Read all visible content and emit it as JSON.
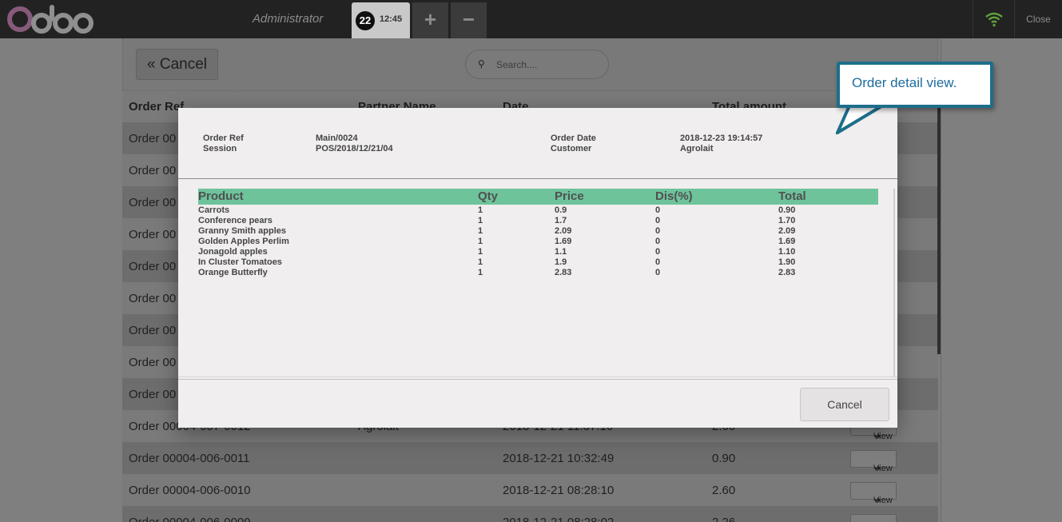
{
  "navbar": {
    "admin": "Administrator",
    "order_number": "22",
    "order_time": "12:45",
    "add_label": "+",
    "remove_label": "−",
    "close_label": "Close",
    "brand_colors": {
      "o1": "#875a7b",
      "o2": "#8f8f8f"
    }
  },
  "list": {
    "cancel_label": "Cancel",
    "search_placeholder": "Search....",
    "headers": {
      "order_ref": "Order Ref",
      "partner": "Partner Name",
      "date": "Date",
      "total": "Total amount"
    },
    "rows": [
      {
        "ref": "Order 00",
        "partner": "",
        "date": "",
        "total": "",
        "view": ""
      },
      {
        "ref": "Order 00",
        "partner": "",
        "date": "",
        "total": "",
        "view": ""
      },
      {
        "ref": "Order 00",
        "partner": "",
        "date": "",
        "total": "",
        "view": ""
      },
      {
        "ref": "Order 00",
        "partner": "",
        "date": "",
        "total": "",
        "view": ""
      },
      {
        "ref": "Order 00",
        "partner": "",
        "date": "",
        "total": "",
        "view": ""
      },
      {
        "ref": "Order 00",
        "partner": "",
        "date": "",
        "total": "",
        "view": ""
      },
      {
        "ref": "Order 00",
        "partner": "",
        "date": "",
        "total": "",
        "view": ""
      },
      {
        "ref": "Order 00",
        "partner": "",
        "date": "",
        "total": "",
        "view": ""
      },
      {
        "ref": "Order 00",
        "partner": "",
        "date": "",
        "total": "",
        "view": ""
      },
      {
        "ref": "Order 00004-007-0012",
        "partner": "Agrolait",
        "date": "2018-12-21 11:37:10",
        "total": "2.60",
        "view": "View"
      },
      {
        "ref": "Order 00004-006-0011",
        "partner": "",
        "date": "2018-12-21 10:32:49",
        "total": "0.90",
        "view": "View"
      },
      {
        "ref": "Order 00004-006-0010",
        "partner": "",
        "date": "2018-12-21 08:28:10",
        "total": "2.60",
        "view": "View"
      },
      {
        "ref": "Order 00004-006-0009",
        "partner": "",
        "date": "2018-12-21 08:28:02",
        "total": "2.26",
        "view": "View"
      }
    ]
  },
  "modal": {
    "order_ref_label": "Order Ref",
    "order_ref_value": "Main/0024",
    "session_label": "Session",
    "session_value": "POS/2018/12/21/04",
    "order_date_label": "Order Date",
    "order_date_value": "2018-12-23 19:14:57",
    "customer_label": "Customer",
    "customer_value": "Agrolait",
    "columns": {
      "product": "Product",
      "qty": "Qty",
      "price": "Price",
      "discount": "Dis(%)",
      "total": "Total"
    },
    "lines": [
      {
        "product": "Carrots",
        "qty": "1",
        "price": "0.9",
        "discount": "0",
        "total": "0.90"
      },
      {
        "product": "Conference pears",
        "qty": "1",
        "price": "1.7",
        "discount": "0",
        "total": "1.70"
      },
      {
        "product": "Granny Smith apples",
        "qty": "1",
        "price": "2.09",
        "discount": "0",
        "total": "2.09"
      },
      {
        "product": "Golden Apples Perlim",
        "qty": "1",
        "price": "1.69",
        "discount": "0",
        "total": "1.69"
      },
      {
        "product": "Jonagold apples",
        "qty": "1",
        "price": "1.1",
        "discount": "0",
        "total": "1.10"
      },
      {
        "product": "In Cluster Tomatoes",
        "qty": "1",
        "price": "1.9",
        "discount": "0",
        "total": "1.90"
      },
      {
        "product": "Orange Butterfly",
        "qty": "1",
        "price": "2.83",
        "discount": "0",
        "total": "2.83"
      }
    ],
    "cancel_label": "Cancel",
    "header_color": "#6ec39b"
  },
  "callout": {
    "text": "Order detail view."
  }
}
